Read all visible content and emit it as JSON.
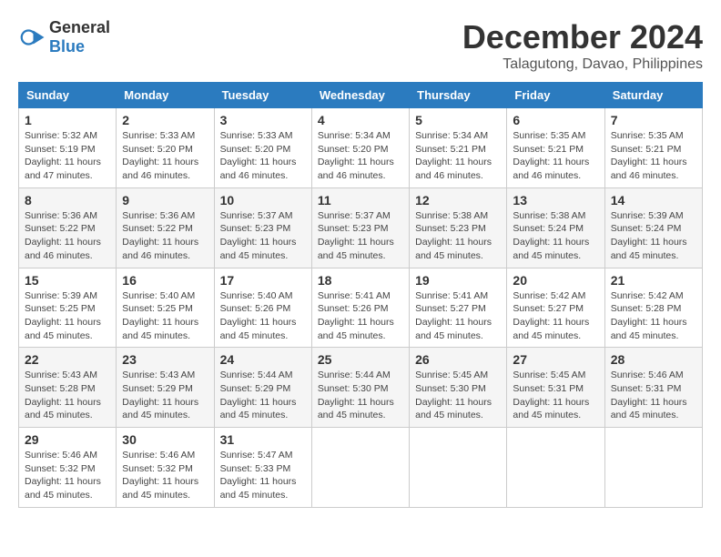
{
  "logo": {
    "text_general": "General",
    "text_blue": "Blue"
  },
  "header": {
    "month_year": "December 2024",
    "location": "Talagutong, Davao, Philippines"
  },
  "weekdays": [
    "Sunday",
    "Monday",
    "Tuesday",
    "Wednesday",
    "Thursday",
    "Friday",
    "Saturday"
  ],
  "weeks": [
    [
      {
        "day": "1",
        "sunrise": "5:32 AM",
        "sunset": "5:19 PM",
        "daylight": "11 hours and 47 minutes."
      },
      {
        "day": "2",
        "sunrise": "5:33 AM",
        "sunset": "5:20 PM",
        "daylight": "11 hours and 46 minutes."
      },
      {
        "day": "3",
        "sunrise": "5:33 AM",
        "sunset": "5:20 PM",
        "daylight": "11 hours and 46 minutes."
      },
      {
        "day": "4",
        "sunrise": "5:34 AM",
        "sunset": "5:20 PM",
        "daylight": "11 hours and 46 minutes."
      },
      {
        "day": "5",
        "sunrise": "5:34 AM",
        "sunset": "5:21 PM",
        "daylight": "11 hours and 46 minutes."
      },
      {
        "day": "6",
        "sunrise": "5:35 AM",
        "sunset": "5:21 PM",
        "daylight": "11 hours and 46 minutes."
      },
      {
        "day": "7",
        "sunrise": "5:35 AM",
        "sunset": "5:21 PM",
        "daylight": "11 hours and 46 minutes."
      }
    ],
    [
      {
        "day": "8",
        "sunrise": "5:36 AM",
        "sunset": "5:22 PM",
        "daylight": "11 hours and 46 minutes."
      },
      {
        "day": "9",
        "sunrise": "5:36 AM",
        "sunset": "5:22 PM",
        "daylight": "11 hours and 46 minutes."
      },
      {
        "day": "10",
        "sunrise": "5:37 AM",
        "sunset": "5:23 PM",
        "daylight": "11 hours and 45 minutes."
      },
      {
        "day": "11",
        "sunrise": "5:37 AM",
        "sunset": "5:23 PM",
        "daylight": "11 hours and 45 minutes."
      },
      {
        "day": "12",
        "sunrise": "5:38 AM",
        "sunset": "5:23 PM",
        "daylight": "11 hours and 45 minutes."
      },
      {
        "day": "13",
        "sunrise": "5:38 AM",
        "sunset": "5:24 PM",
        "daylight": "11 hours and 45 minutes."
      },
      {
        "day": "14",
        "sunrise": "5:39 AM",
        "sunset": "5:24 PM",
        "daylight": "11 hours and 45 minutes."
      }
    ],
    [
      {
        "day": "15",
        "sunrise": "5:39 AM",
        "sunset": "5:25 PM",
        "daylight": "11 hours and 45 minutes."
      },
      {
        "day": "16",
        "sunrise": "5:40 AM",
        "sunset": "5:25 PM",
        "daylight": "11 hours and 45 minutes."
      },
      {
        "day": "17",
        "sunrise": "5:40 AM",
        "sunset": "5:26 PM",
        "daylight": "11 hours and 45 minutes."
      },
      {
        "day": "18",
        "sunrise": "5:41 AM",
        "sunset": "5:26 PM",
        "daylight": "11 hours and 45 minutes."
      },
      {
        "day": "19",
        "sunrise": "5:41 AM",
        "sunset": "5:27 PM",
        "daylight": "11 hours and 45 minutes."
      },
      {
        "day": "20",
        "sunrise": "5:42 AM",
        "sunset": "5:27 PM",
        "daylight": "11 hours and 45 minutes."
      },
      {
        "day": "21",
        "sunrise": "5:42 AM",
        "sunset": "5:28 PM",
        "daylight": "11 hours and 45 minutes."
      }
    ],
    [
      {
        "day": "22",
        "sunrise": "5:43 AM",
        "sunset": "5:28 PM",
        "daylight": "11 hours and 45 minutes."
      },
      {
        "day": "23",
        "sunrise": "5:43 AM",
        "sunset": "5:29 PM",
        "daylight": "11 hours and 45 minutes."
      },
      {
        "day": "24",
        "sunrise": "5:44 AM",
        "sunset": "5:29 PM",
        "daylight": "11 hours and 45 minutes."
      },
      {
        "day": "25",
        "sunrise": "5:44 AM",
        "sunset": "5:30 PM",
        "daylight": "11 hours and 45 minutes."
      },
      {
        "day": "26",
        "sunrise": "5:45 AM",
        "sunset": "5:30 PM",
        "daylight": "11 hours and 45 minutes."
      },
      {
        "day": "27",
        "sunrise": "5:45 AM",
        "sunset": "5:31 PM",
        "daylight": "11 hours and 45 minutes."
      },
      {
        "day": "28",
        "sunrise": "5:46 AM",
        "sunset": "5:31 PM",
        "daylight": "11 hours and 45 minutes."
      }
    ],
    [
      {
        "day": "29",
        "sunrise": "5:46 AM",
        "sunset": "5:32 PM",
        "daylight": "11 hours and 45 minutes."
      },
      {
        "day": "30",
        "sunrise": "5:46 AM",
        "sunset": "5:32 PM",
        "daylight": "11 hours and 45 minutes."
      },
      {
        "day": "31",
        "sunrise": "5:47 AM",
        "sunset": "5:33 PM",
        "daylight": "11 hours and 45 minutes."
      },
      null,
      null,
      null,
      null
    ]
  ]
}
